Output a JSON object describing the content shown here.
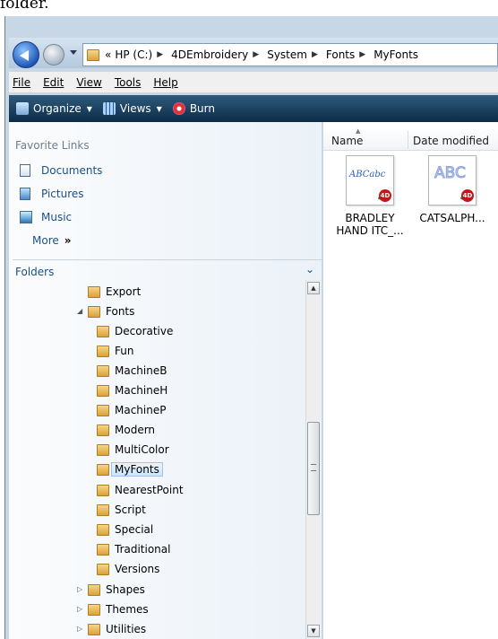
{
  "caption": "folder.",
  "address": {
    "overflow": "«",
    "path": [
      "HP (C:)",
      "4DEmbroidery",
      "System",
      "Fonts",
      "MyFonts"
    ]
  },
  "menu": [
    "File",
    "Edit",
    "View",
    "Tools",
    "Help"
  ],
  "toolbar": {
    "organize": "Organize",
    "views": "Views",
    "burn": "Burn"
  },
  "favorites": {
    "title": "Favorite Links",
    "items": [
      "Documents",
      "Pictures",
      "Music"
    ],
    "more": "More"
  },
  "folders": {
    "title": "Folders",
    "tree": [
      {
        "label": "Export",
        "toggle": ""
      },
      {
        "label": "Fonts",
        "toggle": "▲"
      },
      {
        "label": "Decorative",
        "toggle": ""
      },
      {
        "label": "Fun",
        "toggle": ""
      },
      {
        "label": "MachineB",
        "toggle": ""
      },
      {
        "label": "MachineH",
        "toggle": ""
      },
      {
        "label": "MachineP",
        "toggle": ""
      },
      {
        "label": "Modern",
        "toggle": ""
      },
      {
        "label": "MultiColor",
        "toggle": ""
      },
      {
        "label": "MyFonts",
        "toggle": "",
        "selected": true
      },
      {
        "label": "NearestPoint",
        "toggle": ""
      },
      {
        "label": "Script",
        "toggle": ""
      },
      {
        "label": "Special",
        "toggle": ""
      },
      {
        "label": "Traditional",
        "toggle": ""
      },
      {
        "label": "Versions",
        "toggle": ""
      },
      {
        "label": "Shapes",
        "toggle": "▷"
      },
      {
        "label": "Themes",
        "toggle": "▷"
      },
      {
        "label": "Utilities",
        "toggle": "▷"
      }
    ]
  },
  "columns": [
    "Name",
    "Date modified"
  ],
  "files": [
    {
      "thumb_text": "ABCabc",
      "badge": "4D",
      "name_line1": "BRADLEY",
      "name_line2": "HAND ITC_..."
    },
    {
      "thumb_text": "ABC",
      "badge": "4D",
      "name_line1": "CATSALPH...",
      "name_line2": ""
    }
  ],
  "colors": {
    "toolbar": "#0b2c47",
    "link": "#1a4f8a",
    "selection": "#cde4f9"
  }
}
